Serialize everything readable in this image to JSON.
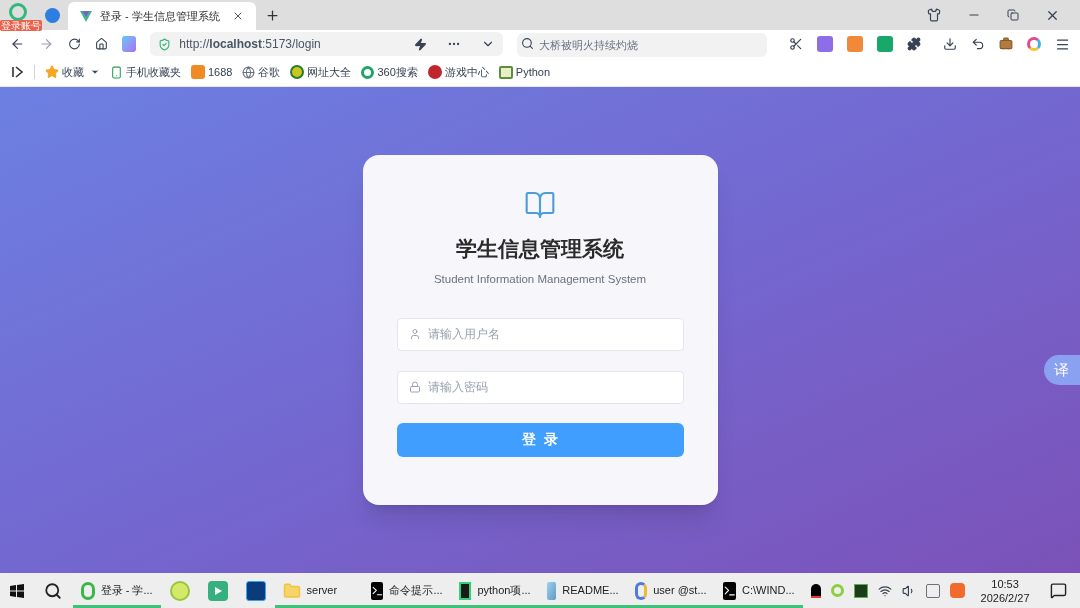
{
  "browser": {
    "badge": "登录账号",
    "tabs": [
      {
        "title": "登录 - 学生信息管理系统",
        "selected": true
      }
    ],
    "url": "http://**localhost**:5173/login",
    "search": {
      "placeholder": "大桥被明火持续灼烧"
    },
    "bookmarks": [
      "收藏",
      "手机收藏夹",
      "1688",
      "谷歌",
      "网址大全",
      "360搜索",
      "游戏中心",
      "Python"
    ]
  },
  "login": {
    "title": "学生信息管理系统",
    "subtitle": "Student Information Management System",
    "username": {
      "placeholder": "请输入用户名"
    },
    "password": {
      "placeholder": "请输入密码"
    },
    "submit": "登  录"
  },
  "translate_button": "译",
  "taskbar": {
    "items": [
      {
        "label": "登录 - 学...",
        "open": true
      },
      {
        "open": false
      },
      {
        "open": false
      },
      {
        "open": false
      },
      {
        "label": "server",
        "open": true
      },
      {
        "label": "命令提示...",
        "open": true
      },
      {
        "label": "python项...",
        "open": true
      },
      {
        "label": "README...",
        "open": true
      },
      {
        "label": "user @st...",
        "open": true
      },
      {
        "label": "C:\\WIND...",
        "open": true
      }
    ],
    "time": "10:53",
    "date": "2026/2/27"
  }
}
